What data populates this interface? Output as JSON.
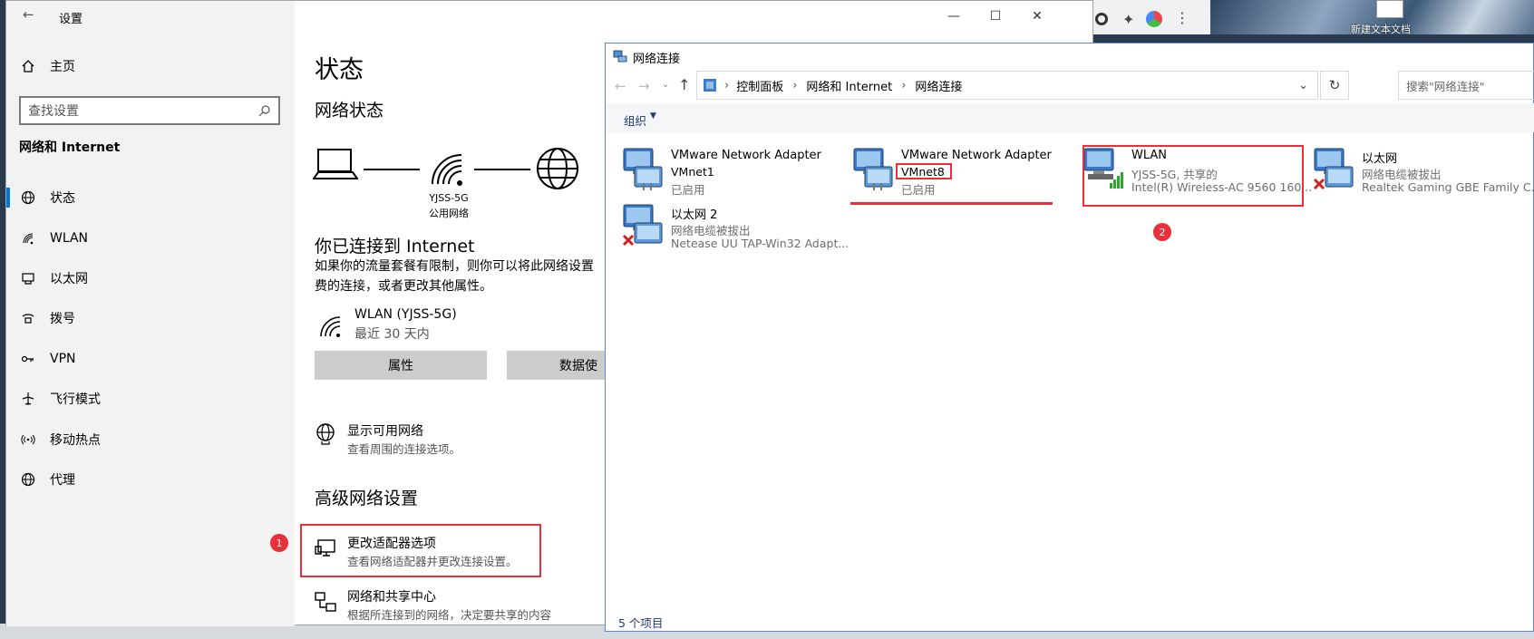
{
  "settings": {
    "back_label": "←",
    "title": "设置",
    "home_label": "主页",
    "search_placeholder": "查找设置",
    "section_title": "网络和 Internet",
    "nav": [
      {
        "label": "状态",
        "icon": "status-icon"
      },
      {
        "label": "WLAN",
        "icon": "wifi-icon"
      },
      {
        "label": "以太网",
        "icon": "ethernet-icon"
      },
      {
        "label": "拨号",
        "icon": "dialup-icon"
      },
      {
        "label": "VPN",
        "icon": "vpn-icon"
      },
      {
        "label": "飞行模式",
        "icon": "airplane-icon"
      },
      {
        "label": "移动热点",
        "icon": "hotspot-icon"
      },
      {
        "label": "代理",
        "icon": "globe-icon"
      }
    ],
    "window_controls": {
      "minimize": "—",
      "maximize": "☐",
      "close": "✕"
    }
  },
  "status_page": {
    "heading": "状态",
    "network_status": "网络状态",
    "network_name": "YJSS-5G",
    "network_type": "公用网络",
    "connected_title": "你已连接到 Internet",
    "connected_desc_1": "如果你的流量套餐有限制，则你可以将此网络设置",
    "connected_desc_2": "费的连接，或者更改其他属性。",
    "wlan_name": "WLAN (YJSS-5G)",
    "wlan_usage": "最近 30 天内",
    "properties_button": "属性",
    "data_usage_button": "数据使",
    "show_networks_title": "显示可用网络",
    "show_networks_desc": "查看周围的连接选项。",
    "advanced_heading": "高级网络设置",
    "adapter_options_title": "更改适配器选项",
    "adapter_options_desc": "查看网络适配器并更改连接设置。",
    "sharing_center_title": "网络和共享中心",
    "sharing_center_desc": "根据所连接到的网络，决定要共享的内容"
  },
  "badges": {
    "one": "1",
    "two": "2"
  },
  "net_window": {
    "title": "网络连接",
    "breadcrumb": [
      "控制面板",
      "网络和 Internet",
      "网络连接"
    ],
    "search_placeholder": "搜索\"网络连接\"",
    "organize_label": "组织",
    "status_bar": "5 个项目",
    "adapters": [
      {
        "name": "VMware Network Adapter",
        "line2": "VMnet1",
        "line3": "已启用",
        "state": "enabled"
      },
      {
        "name": "VMware Network Adapter",
        "line2": "VMnet8",
        "line3": "已启用",
        "state": "enabled"
      },
      {
        "name": "WLAN",
        "line2": "YJSS-5G, 共享的",
        "line3": "Intel(R) Wireless-AC 9560 160...",
        "state": "wireless"
      },
      {
        "name": "以太网",
        "line2": "网络电缆被拔出",
        "line3": "Realtek Gaming GBE Family C...",
        "state": "unplugged"
      },
      {
        "name": "以太网 2",
        "line2": "网络电缆被拔出",
        "line3": "Netease UU TAP-Win32 Adapt...",
        "state": "unplugged"
      }
    ]
  },
  "desktop": {
    "icon_label": "新建文本文档"
  },
  "colors": {
    "accent": "#0078d7",
    "highlight": "#e8303a"
  }
}
